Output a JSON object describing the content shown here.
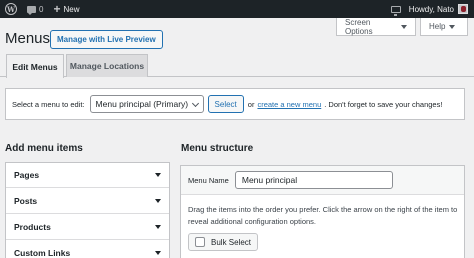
{
  "admin_bar": {
    "comments_count": "0",
    "new_label": "New",
    "greeting": "Howdy, Nato"
  },
  "screen_options": {
    "label": "Screen Options"
  },
  "help": {
    "label": "Help"
  },
  "page": {
    "title": "Menus",
    "live_preview_label": "Manage with Live Preview"
  },
  "nav_tabs": [
    {
      "label": "Edit Menus",
      "active": true
    },
    {
      "label": "Manage Locations",
      "active": false
    }
  ],
  "select_bar": {
    "label": "Select a menu to edit:",
    "selected_menu": "Menu principal (Primary)",
    "select_button": "Select",
    "or_text": "or",
    "create_link": "create a new menu",
    "hint": ". Don't forget to save your changes!"
  },
  "add_items": {
    "heading": "Add menu items",
    "sections": [
      "Pages",
      "Posts",
      "Products",
      "Custom Links"
    ]
  },
  "structure": {
    "heading": "Menu structure",
    "name_label": "Menu Name",
    "name_value": "Menu principal",
    "help_text": "Drag the items into the order you prefer. Click the arrow on the right of the item to reveal additional configuration options.",
    "bulk_select_label": "Bulk Select"
  },
  "colors": {
    "admin_bar_bg": "#1d2327",
    "accent": "#2271b1",
    "page_bg": "#f0f0f1"
  }
}
